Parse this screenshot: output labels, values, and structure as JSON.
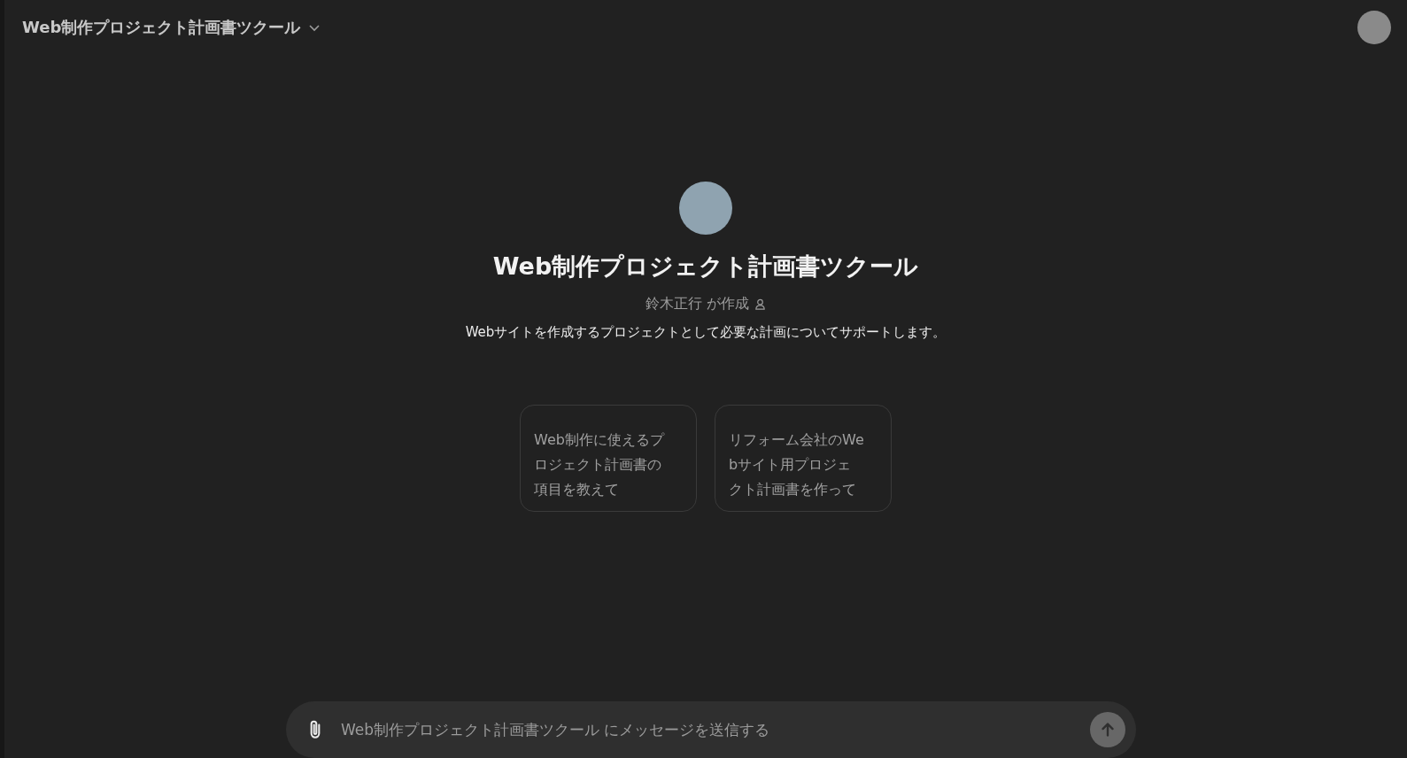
{
  "header": {
    "title": "Web制作プロジェクト計画書ツクール"
  },
  "gpt": {
    "name": "Web制作プロジェクト計画書ツクール",
    "author": "鈴木正行 が作成",
    "description": "Webサイトを作成するプロジェクトとして必要な計画についてサポートします。"
  },
  "suggestions": [
    "Web制作に使えるプロジェクト計画書の項目を教えて",
    "リフォーム会社のWebサイト用プロジェクト計画書を作って"
  ],
  "composer": {
    "placeholder": "Web制作プロジェクト計画書ツクール にメッセージを送信する"
  }
}
